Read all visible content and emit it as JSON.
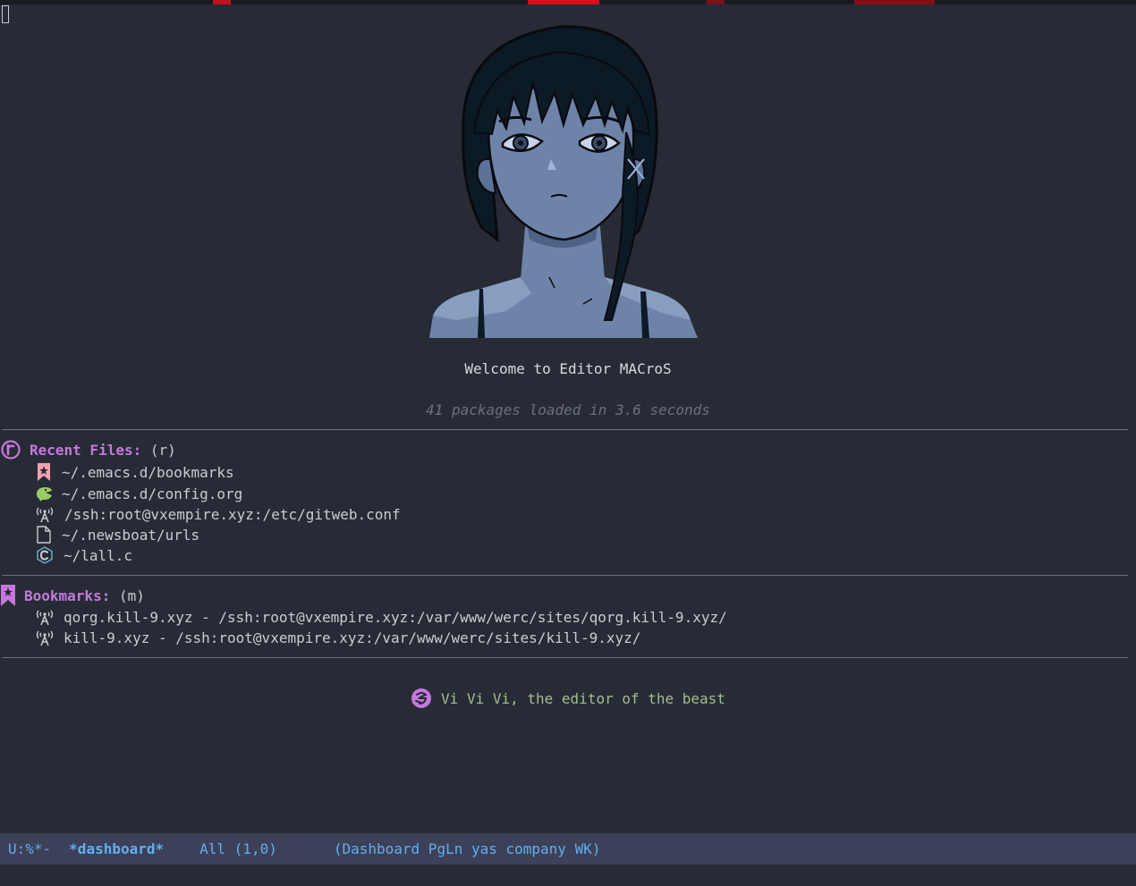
{
  "window": {
    "title": "*dashboard*"
  },
  "dashboard": {
    "welcome": "Welcome to Editor MACroS",
    "loaded": "41 packages loaded in 3.6 seconds",
    "recent": {
      "title": "Recent Files:",
      "key": " (r)",
      "items": [
        {
          "icon": "bookmark-file-icon",
          "label": "~/.emacs.d/bookmarks"
        },
        {
          "icon": "org-file-icon",
          "label": "~/.emacs.d/config.org"
        },
        {
          "icon": "remote-file-icon",
          "label": "/ssh:root@vxempire.xyz:/etc/gitweb.conf"
        },
        {
          "icon": "text-file-icon",
          "label": "~/.newsboat/urls"
        },
        {
          "icon": "c-file-icon",
          "label": "~/lall.c"
        }
      ]
    },
    "bookmarks": {
      "title": "Bookmarks:",
      "key": " (m)",
      "items": [
        {
          "icon": "remote-bookmark-icon",
          "label": "qorg.kill-9.xyz - /ssh:root@vxempire.xyz:/var/www/werc/sites/qorg.kill-9.xyz/"
        },
        {
          "icon": "remote-bookmark-icon",
          "label": "kill-9.xyz - /ssh:root@vxempire.xyz:/var/www/werc/sites/kill-9.xyz/"
        }
      ]
    },
    "footer": "Vi Vi Vi, the editor of the beast"
  },
  "modeline": {
    "state": "U:%*-",
    "buffer": "*dashboard*",
    "position": "All (1,0)",
    "modes": "(Dashboard PgLn yas company WK)"
  },
  "colors": {
    "background": "#272b36",
    "heading": "#c678dd",
    "footer_text": "#a3be8c",
    "modeline_bg": "#3c4058",
    "modeline_text": "#61afef"
  }
}
